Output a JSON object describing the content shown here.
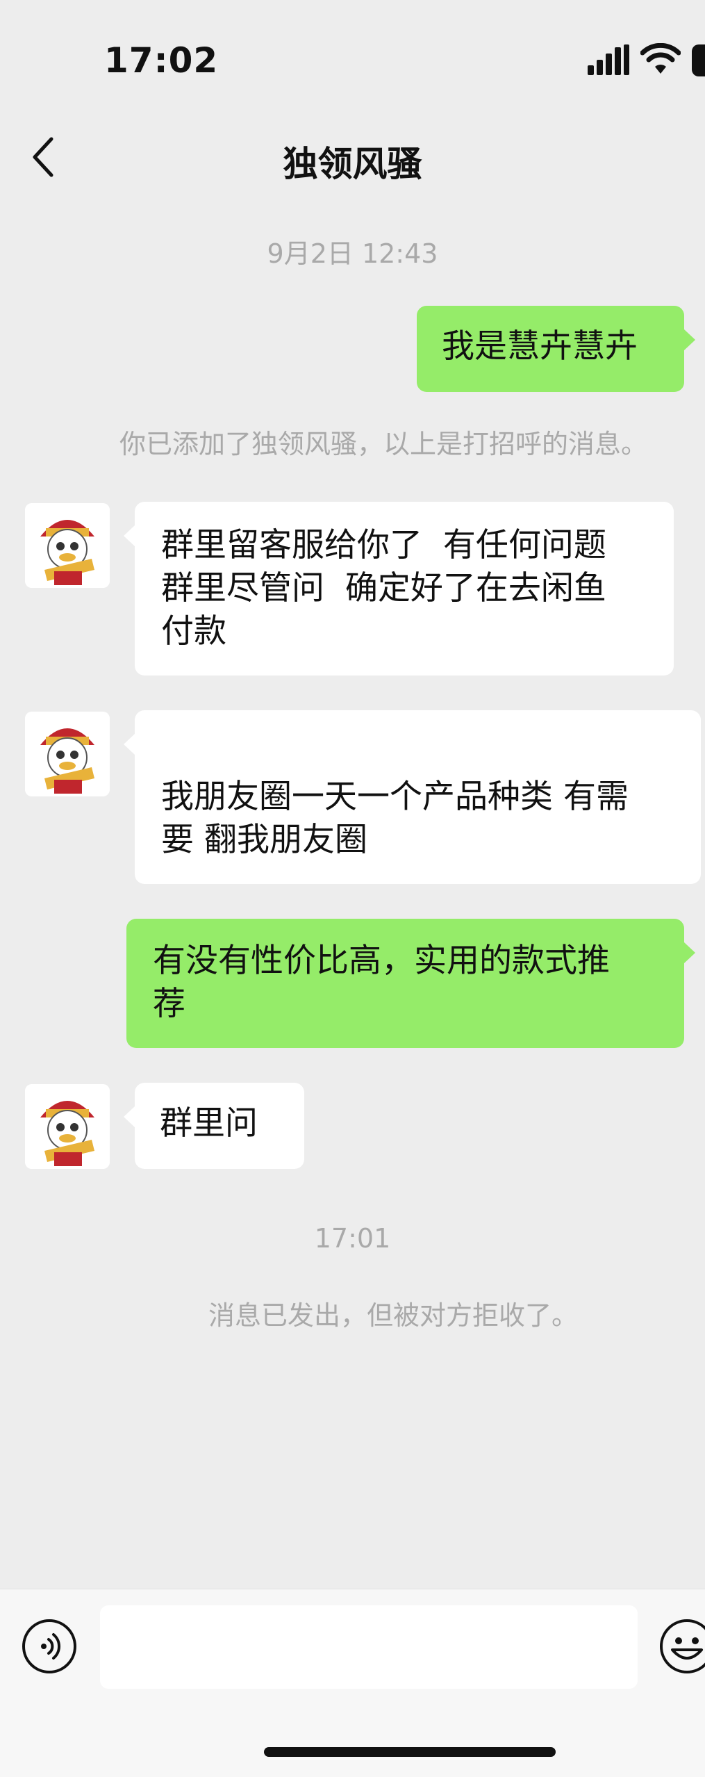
{
  "status_bar": {
    "time": "17:02"
  },
  "nav": {
    "title": "独领风骚",
    "back_icon": "chevron-left-icon"
  },
  "messages": [
    {
      "type": "time",
      "text": "9月2日 12:43"
    },
    {
      "type": "outgoing",
      "text": "我是慧卉慧卉"
    },
    {
      "type": "system",
      "text": "你已添加了独领风骚，以上是打招呼的消息。"
    },
    {
      "type": "incoming",
      "text": "群里留客服给你了  有任何问题\n群里尽管问  确定好了在去闲鱼\n付款"
    },
    {
      "type": "incoming",
      "text": "\n我朋友圈一天一个产品种类 有需\n要 翻我朋友圈"
    },
    {
      "type": "outgoing",
      "text": "有没有性价比高，实用的款式推\n荐"
    },
    {
      "type": "incoming",
      "text": "群里问"
    },
    {
      "type": "time",
      "text": "17:01"
    },
    {
      "type": "system",
      "text": "消息已发出，但被对方拒收了。"
    }
  ],
  "input_bar": {
    "voice_icon": "voice-icon",
    "emoji_icon": "emoji-icon",
    "input_value": ""
  },
  "colors": {
    "background": "#ededed",
    "outgoing_bubble": "#95ec69",
    "incoming_bubble": "#ffffff",
    "meta_text": "#a9a9a9"
  }
}
